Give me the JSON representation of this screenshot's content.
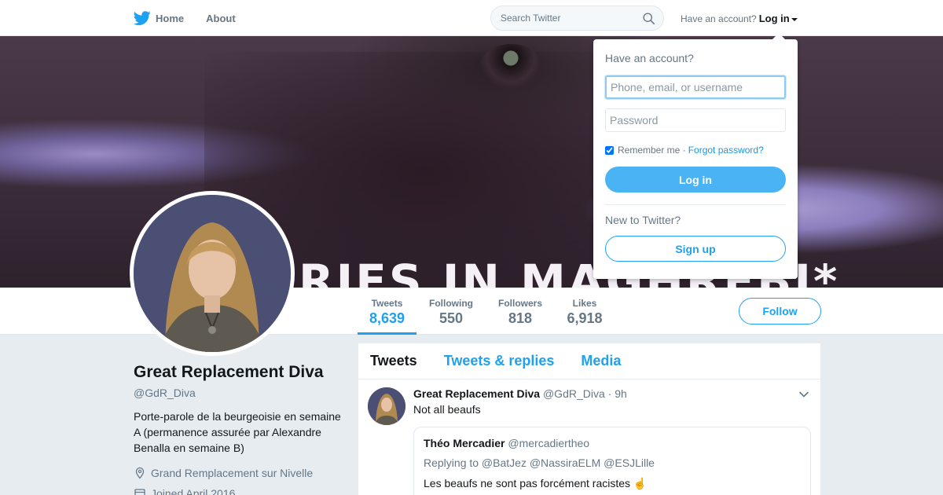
{
  "nav": {
    "home_label": "Home",
    "about_label": "About",
    "search_placeholder": "Search Twitter",
    "account_prompt": "Have an account?",
    "login_label": "Log in"
  },
  "banner": {
    "overlay_text": "RIES IN MAGHREBI*"
  },
  "stats": [
    {
      "label": "Tweets",
      "value": "8,639",
      "active": true
    },
    {
      "label": "Following",
      "value": "550"
    },
    {
      "label": "Followers",
      "value": "818"
    },
    {
      "label": "Likes",
      "value": "6,918"
    }
  ],
  "follow_label": "Follow",
  "profile": {
    "name": "Great Replacement Diva",
    "handle": "@GdR_Diva",
    "bio": "Porte-parole de la beurgeoisie en semaine A (permanence assurée par Alexandre Benalla en semaine B)",
    "location": "Grand Remplacement sur Nivelle",
    "joined": "Joined April 2016"
  },
  "timeline": {
    "tabs": [
      {
        "label": "Tweets",
        "active": true
      },
      {
        "label": "Tweets & replies"
      },
      {
        "label": "Media"
      }
    ],
    "tweet": {
      "name": "Great Replacement Diva",
      "handle": "@GdR_Diva",
      "time": "· 9h",
      "text": "Not all beaufs",
      "quote": {
        "name": "Théo Mercadier",
        "handle": "@mercadiertheo",
        "replying_to": "Replying to @BatJez @NassiraELM @ESJLille",
        "text": "Les beaufs ne sont pas forcément racistes ☝️"
      }
    }
  },
  "login_dropdown": {
    "title": "Have an account?",
    "username_placeholder": "Phone, email, or username",
    "password_placeholder": "Password",
    "remember_label": "Remember me",
    "separator": "·",
    "forgot_label": "Forgot password?",
    "login_button": "Log in",
    "new_prompt": "New to Twitter?",
    "signup_button": "Sign up"
  },
  "colors": {
    "accent": "#1da1f2",
    "login_button": "#4ab3f4",
    "page_bg": "#e6ecf0"
  }
}
